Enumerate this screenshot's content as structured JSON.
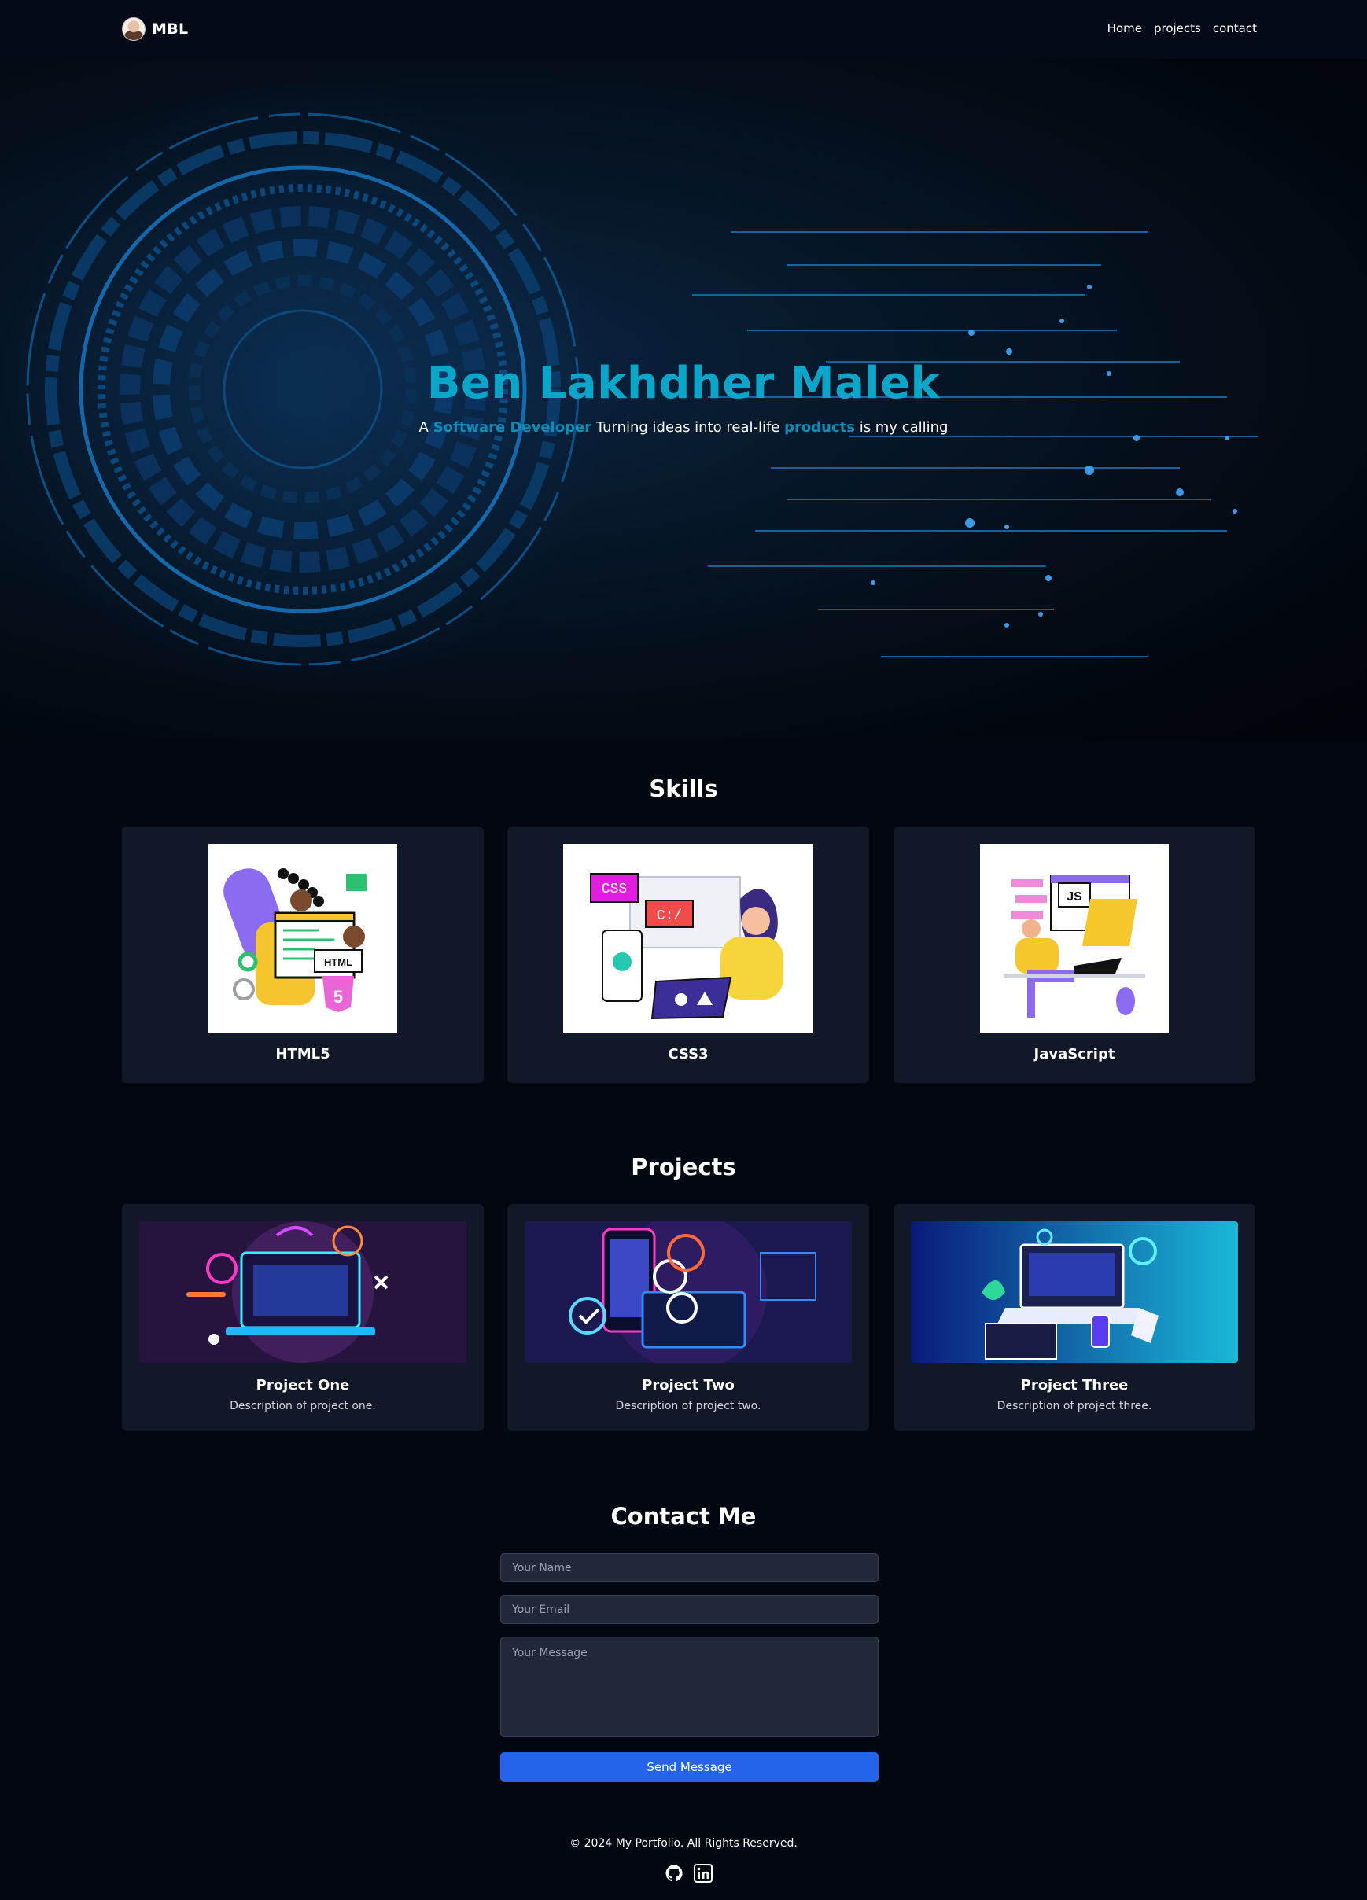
{
  "navbar": {
    "brand": "MBL",
    "links": [
      "Home",
      "projects",
      "contact"
    ]
  },
  "hero": {
    "title": "Ben Lakhdher Malek",
    "subtitle": {
      "prefix": "A",
      "role": "Software Developer",
      "middle": "Turning ideas into real-life",
      "products": "products",
      "suffix": "is my calling"
    }
  },
  "skills": {
    "title": "Skills",
    "items": [
      {
        "name": "HTML5",
        "icon": "html-illustration"
      },
      {
        "name": "CSS3",
        "icon": "css-illustration"
      },
      {
        "name": "JavaScript",
        "icon": "js-illustration"
      }
    ],
    "illustration_text": {
      "html": "HTML",
      "html5": "5",
      "css": "CSS",
      "cpath": "C:/",
      "js": "JS"
    }
  },
  "projects": {
    "title": "Projects",
    "items": [
      {
        "name": "Project One",
        "description": "Description of project one."
      },
      {
        "name": "Project Two",
        "description": "Description of project two."
      },
      {
        "name": "Project Three",
        "description": "Description of project three."
      }
    ]
  },
  "contact": {
    "title": "Contact Me",
    "name_placeholder": "Your Name",
    "email_placeholder": "Your Email",
    "message_placeholder": "Your Message",
    "send_label": "Send Message"
  },
  "footer": {
    "copyright": "© 2024 My Portfolio. All Rights Reserved.",
    "social": [
      "github-icon",
      "linkedin-icon"
    ]
  },
  "colors": {
    "accent": "#0aa6c9",
    "highlight": "#0b8db5",
    "button": "#2563eb",
    "card": "#111827",
    "background": "#030712"
  }
}
